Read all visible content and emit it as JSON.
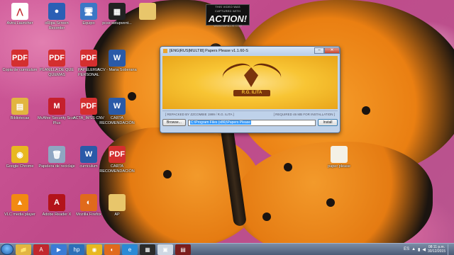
{
  "watermark": {
    "top": "THIS VIDEO WAS CAPTURED WITH",
    "brand": "ACTION!",
    "site": "WWW.MIRILLIS.COM"
  },
  "desktop_icons": [
    {
      "label": "Avira Launcher",
      "icon": "avira-icon",
      "color": "#ffffff",
      "glyph": "⋀"
    },
    {
      "label": "oRipa Screen Recorder",
      "icon": "recorder-icon",
      "color": "#2b5fb5",
      "glyph": "●"
    },
    {
      "label": "Equipo",
      "icon": "computer-icon",
      "color": "#3b77c5",
      "glyph": "🖥"
    },
    {
      "label": "pcsx-setupvent...",
      "icon": "app-icon",
      "color": "#222222",
      "glyph": "▦"
    },
    {
      "label": "",
      "icon": "folder-icon",
      "color": "#e8c66b",
      "glyph": ""
    },
    {
      "label": "Copia de curriculum",
      "icon": "pdf-icon",
      "color": "#d42f2f",
      "glyph": "PDF"
    },
    {
      "label": "PLANILLA DE QUE QUEMAS",
      "icon": "pdf-icon",
      "color": "#d42f2f",
      "glyph": "PDF"
    },
    {
      "label": "PAPELERIA PERSONAL",
      "icon": "pdf-icon",
      "color": "#d42f2f",
      "glyph": "PDF"
    },
    {
      "label": "ACV - Maria Soberana",
      "icon": "word-icon",
      "color": "#2a5aa8",
      "glyph": "W"
    },
    {
      "label": "Bibliotecas",
      "icon": "libraries-icon",
      "color": "#e2b540",
      "glyph": "▤"
    },
    {
      "label": "McAfee Security Scan Plus",
      "icon": "mcafee-icon",
      "color": "#c5202c",
      "glyph": "M"
    },
    {
      "label": "ACTA_IMSS CNV",
      "icon": "pdf-icon",
      "color": "#d42f2f",
      "glyph": "PDF"
    },
    {
      "label": "CARTA RECOMENDACIÓN",
      "icon": "word-icon",
      "color": "#2a5aa8",
      "glyph": "W"
    },
    {
      "label": "Google Chrome",
      "icon": "chrome-icon",
      "color": "#e8b820",
      "glyph": "◉"
    },
    {
      "label": "Papelera de reciclaje",
      "icon": "recycle-bin-icon",
      "color": "#8fa6c2",
      "glyph": "🗑"
    },
    {
      "label": "curriculum",
      "icon": "word-icon",
      "color": "#2a5aa8",
      "glyph": "W"
    },
    {
      "label": "CARTA RECOMENDACIÓN",
      "icon": "pdf-icon",
      "color": "#d42f2f",
      "glyph": "PDF"
    },
    {
      "label": "VLC media player",
      "icon": "vlc-icon",
      "color": "#f28a12",
      "glyph": "▲"
    },
    {
      "label": "Adobe Reader X",
      "icon": "adobe-reader-icon",
      "color": "#b3131a",
      "glyph": "A"
    },
    {
      "label": "Mozilla Firefox",
      "icon": "firefox-icon",
      "color": "#e06a1c",
      "glyph": "◐"
    },
    {
      "label": "AP",
      "icon": "folder-icon",
      "color": "#e8c66b",
      "glyph": ""
    },
    {
      "label": "paper please",
      "icon": "folder-icon",
      "color": "#f4f1e6",
      "glyph": ""
    }
  ],
  "installer": {
    "title": "[ENG|RUS|MULTI8] Papers Please v1.1.60-S",
    "logo_text": "R.G. ILITA",
    "repack_info": "[ REPACKED BY ZZCOMBIE 1999 / R.G. ILITA ]",
    "required_space": "[ REQUIRED 46 MB FOR INSTALLATION ]",
    "browse_label": "Browse...",
    "path_value": "C:\\Program Files (x86)\\Papers Please",
    "install_label": "Install",
    "minimize_glyph": "–",
    "close_glyph": "✕"
  },
  "taskbar": {
    "items": [
      {
        "name": "explorer-icon",
        "glyph": "📁",
        "color": "#e2b540"
      },
      {
        "name": "action-recorder-icon",
        "glyph": "A",
        "color": "#c1272d"
      },
      {
        "name": "media-player-icon",
        "glyph": "▶",
        "color": "#3a7bd5"
      },
      {
        "name": "hp-icon",
        "glyph": "hp",
        "color": "#2c6fb8"
      },
      {
        "name": "chrome-icon",
        "glyph": "◉",
        "color": "#e8b820"
      },
      {
        "name": "firefox-icon",
        "glyph": "◐",
        "color": "#e06a1c"
      },
      {
        "name": "ie-icon",
        "glyph": "e",
        "color": "#2a8ad6"
      },
      {
        "name": "game-icon",
        "glyph": "▦",
        "color": "#2b2b2b"
      },
      {
        "name": "installer-icon",
        "glyph": "▣",
        "color": "#cfd8e4"
      },
      {
        "name": "papers-please-icon",
        "glyph": "▤",
        "color": "#7a1d1d"
      }
    ],
    "language": "ES",
    "time": "08:11 p.m.",
    "date": "30/12/2015"
  }
}
